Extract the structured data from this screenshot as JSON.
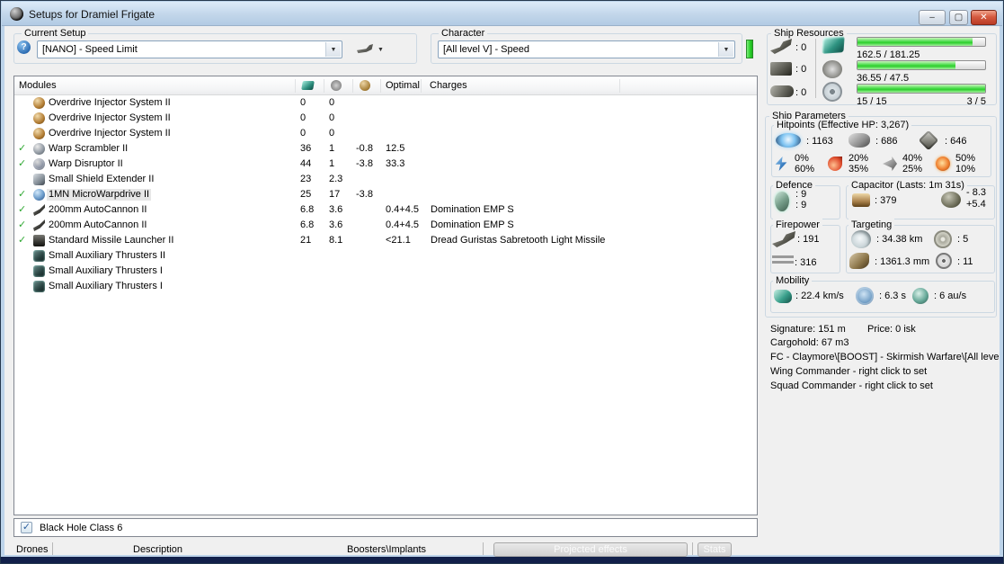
{
  "window": {
    "title": "Setups for Dramiel Frigate",
    "controls": {
      "minimize": "–",
      "maximize": "▢",
      "close": "✕"
    }
  },
  "toolbar": {
    "current_setup": {
      "label": "Current Setup",
      "help_glyph": "?",
      "value": "[NANO] - Speed Limit"
    },
    "character": {
      "label": "Character",
      "value": "[All level V] - Speed"
    },
    "dropdown_arrow": "▼"
  },
  "modules_table": {
    "header": {
      "modules": "Modules",
      "optimal": "Optimal",
      "charges": "Charges"
    },
    "check_glyph": "✓",
    "rows": [
      {
        "check": false,
        "selected": false,
        "icon": "overdrive",
        "name": "Overdrive Injector System II",
        "cpu": "0",
        "pg": "0",
        "cap": "",
        "optimal": "",
        "charges": ""
      },
      {
        "check": false,
        "selected": false,
        "icon": "overdrive",
        "name": "Overdrive Injector System II",
        "cpu": "0",
        "pg": "0",
        "cap": "",
        "optimal": "",
        "charges": ""
      },
      {
        "check": false,
        "selected": false,
        "icon": "overdrive",
        "name": "Overdrive Injector System II",
        "cpu": "0",
        "pg": "0",
        "cap": "",
        "optimal": "",
        "charges": ""
      },
      {
        "check": true,
        "selected": false,
        "icon": "warp-scrambler",
        "name": "Warp Scrambler II",
        "cpu": "36",
        "pg": "1",
        "cap": "-0.8",
        "optimal": "12.5",
        "charges": ""
      },
      {
        "check": true,
        "selected": false,
        "icon": "warp-disruptor",
        "name": "Warp Disruptor II",
        "cpu": "44",
        "pg": "1",
        "cap": "-3.8",
        "optimal": "33.3",
        "charges": ""
      },
      {
        "check": false,
        "selected": false,
        "icon": "shield-extender",
        "name": "Small Shield Extender II",
        "cpu": "23",
        "pg": "2.3",
        "cap": "",
        "optimal": "",
        "charges": ""
      },
      {
        "check": true,
        "selected": true,
        "icon": "microwarpdrive",
        "name": "1MN MicroWarpdrive II",
        "cpu": "25",
        "pg": "17",
        "cap": "-3.8",
        "optimal": "",
        "charges": ""
      },
      {
        "check": true,
        "selected": false,
        "icon": "autocannon",
        "name": "200mm AutoCannon II",
        "cpu": "6.8",
        "pg": "3.6",
        "cap": "",
        "optimal": "0.4+4.5",
        "charges": "Domination EMP S"
      },
      {
        "check": true,
        "selected": false,
        "icon": "autocannon",
        "name": "200mm AutoCannon II",
        "cpu": "6.8",
        "pg": "3.6",
        "cap": "",
        "optimal": "0.4+4.5",
        "charges": "Domination EMP S"
      },
      {
        "check": true,
        "selected": false,
        "icon": "missile-launcher",
        "name": "Standard Missile Launcher II",
        "cpu": "21",
        "pg": "8.1",
        "cap": "",
        "optimal": "<21.1",
        "charges": "Dread Guristas Sabretooth Light Missile"
      },
      {
        "check": false,
        "selected": false,
        "icon": "rig",
        "name": "Small Auxiliary Thrusters II",
        "cpu": "",
        "pg": "",
        "cap": "",
        "optimal": "",
        "charges": ""
      },
      {
        "check": false,
        "selected": false,
        "icon": "rig",
        "name": "Small Auxiliary Thrusters I",
        "cpu": "",
        "pg": "",
        "cap": "",
        "optimal": "",
        "charges": ""
      },
      {
        "check": false,
        "selected": false,
        "icon": "rig",
        "name": "Small Auxiliary Thrusters I",
        "cpu": "",
        "pg": "",
        "cap": "",
        "optimal": "",
        "charges": ""
      }
    ]
  },
  "ship_resources": {
    "label": "Ship Resources",
    "hardpoints": [
      {
        "icon": "turret-hardpoint",
        "value": ": 0"
      },
      {
        "icon": "launcher-hardpoint",
        "value": ": 0"
      },
      {
        "icon": "rig-slot",
        "value": ": 0"
      }
    ],
    "bars": [
      {
        "icon": "cpu",
        "text": "162.5 / 181.25",
        "pct": 90
      },
      {
        "icon": "powergrid",
        "text": "36.55 / 47.5",
        "pct": 77
      },
      {
        "icon": "calibration",
        "text": "15 / 15",
        "right_text": "3 / 5",
        "pct": 100
      }
    ]
  },
  "ship_parameters": {
    "label": "Ship Parameters",
    "hitpoints": {
      "label": "Hitpoints (Effective HP: 3,267)",
      "shield": ": 1163",
      "armor": ": 686",
      "structure": ": 646",
      "resists": [
        {
          "icon": "em-resist",
          "shield_pct": "0%",
          "armor_pct": "60%"
        },
        {
          "icon": "thermal-resist",
          "shield_pct": "20%",
          "armor_pct": "35%"
        },
        {
          "icon": "kinetic-resist",
          "shield_pct": "40%",
          "armor_pct": "25%"
        },
        {
          "icon": "explosive-resist",
          "shield_pct": "50%",
          "armor_pct": "10%"
        }
      ]
    },
    "defence": {
      "label": "Defence",
      "top": ": 9",
      "bottom": ": 9"
    },
    "capacitor": {
      "label": "Capacitor (Lasts: 1m 31s)",
      "amount": ": 379",
      "drain": "- 8.3",
      "recharge": "+5.4"
    },
    "firepower": {
      "label": "Firepower",
      "volley": ": 191",
      "dps": ": 316"
    },
    "targeting": {
      "label": "Targeting",
      "range": ": 34.38 km",
      "max_targets": ": 5",
      "scan_resolution": ": 1361.3 mm",
      "sensor_strength": ": 11"
    },
    "mobility": {
      "label": "Mobility",
      "max_speed": ": 22.4 km/s",
      "align_time": ": 6.3 s",
      "warp_speed": ": 6 au/s"
    }
  },
  "info": {
    "signature": "Signature: 151 m",
    "price": "Price: 0 isk",
    "cargohold": "Cargohold: 67 m3",
    "fleet": "FC - Claymore\\[BOOST] - Skirmish Warfare\\[All level",
    "wing": "Wing Commander - right click to set",
    "squad": "Squad Commander - right click to set"
  },
  "environment": {
    "checked": true,
    "check_glyph": "✓",
    "label": "Black Hole Class 6"
  },
  "statusbar": {
    "drones": "Drones",
    "description": "Description",
    "boosters": "Boosters\\Implants",
    "projected_effects": "Projected effects",
    "stats": "Stats"
  },
  "colors": {
    "progress_green": "#3ed63e",
    "character_bar_green": "#2ed22e",
    "close_button_red": "#c6493a",
    "check_green": "#2fa832"
  }
}
